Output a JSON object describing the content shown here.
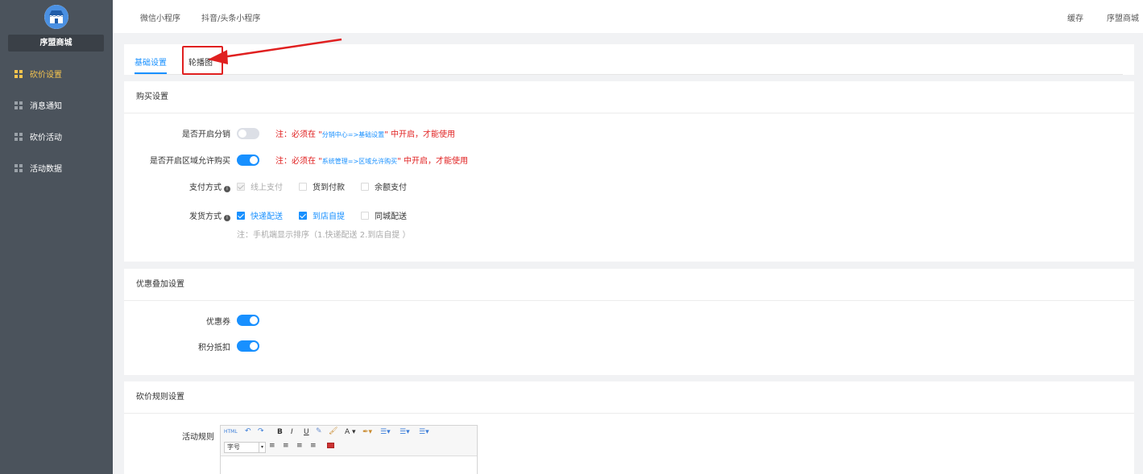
{
  "sidebar": {
    "shop_name": "序盟商城",
    "items": [
      {
        "label": "砍价设置",
        "active": true
      },
      {
        "label": "消息通知",
        "active": false
      },
      {
        "label": "砍价活动",
        "active": false
      },
      {
        "label": "活动数据",
        "active": false
      }
    ]
  },
  "topbar": {
    "tabs": [
      "微信小程序",
      "抖音/头条小程序"
    ],
    "cache": "缓存",
    "user": "序盟商城"
  },
  "tabs": {
    "basic": "基础设置",
    "carousel": "轮播图"
  },
  "purchase": {
    "title": "购买设置",
    "distribution_label": "是否开启分销",
    "distribution_on": false,
    "distribution_note_prefix": "注：必须在 \"",
    "distribution_note_path": "分销中心=>基础设置",
    "distribution_note_suffix": "\" 中开启，才能使用",
    "region_label": "是否开启区域允许购买",
    "region_on": true,
    "region_note_prefix": "注：必须在 \"",
    "region_note_path": "系统管理=>区域允许购买",
    "region_note_suffix": "\" 中开启，才能使用",
    "payment_label": "支付方式",
    "payment_options": [
      {
        "label": "线上支付",
        "state": "disabled"
      },
      {
        "label": "货到付款",
        "state": "unchecked"
      },
      {
        "label": "余额支付",
        "state": "unchecked"
      }
    ],
    "delivery_label": "发货方式",
    "delivery_options": [
      {
        "label": "快递配送",
        "state": "checked"
      },
      {
        "label": "到店自提",
        "state": "checked"
      },
      {
        "label": "同城配送",
        "state": "unchecked"
      }
    ],
    "delivery_hint": "注：手机端显示排序（1.快递配送 2.到店自提 ）"
  },
  "discount": {
    "title": "优惠叠加设置",
    "coupon_label": "优惠券",
    "coupon_on": true,
    "points_label": "积分抵扣",
    "points_on": true
  },
  "rules": {
    "title": "砍价规则设置",
    "activity_label": "活动规则",
    "font_select": "字号",
    "html_btn": "HTML"
  },
  "colors": {
    "accent": "#1890ff",
    "sidebar_bg": "#4b535c",
    "active_menu": "#f5c44f",
    "warning": "#e02020"
  }
}
